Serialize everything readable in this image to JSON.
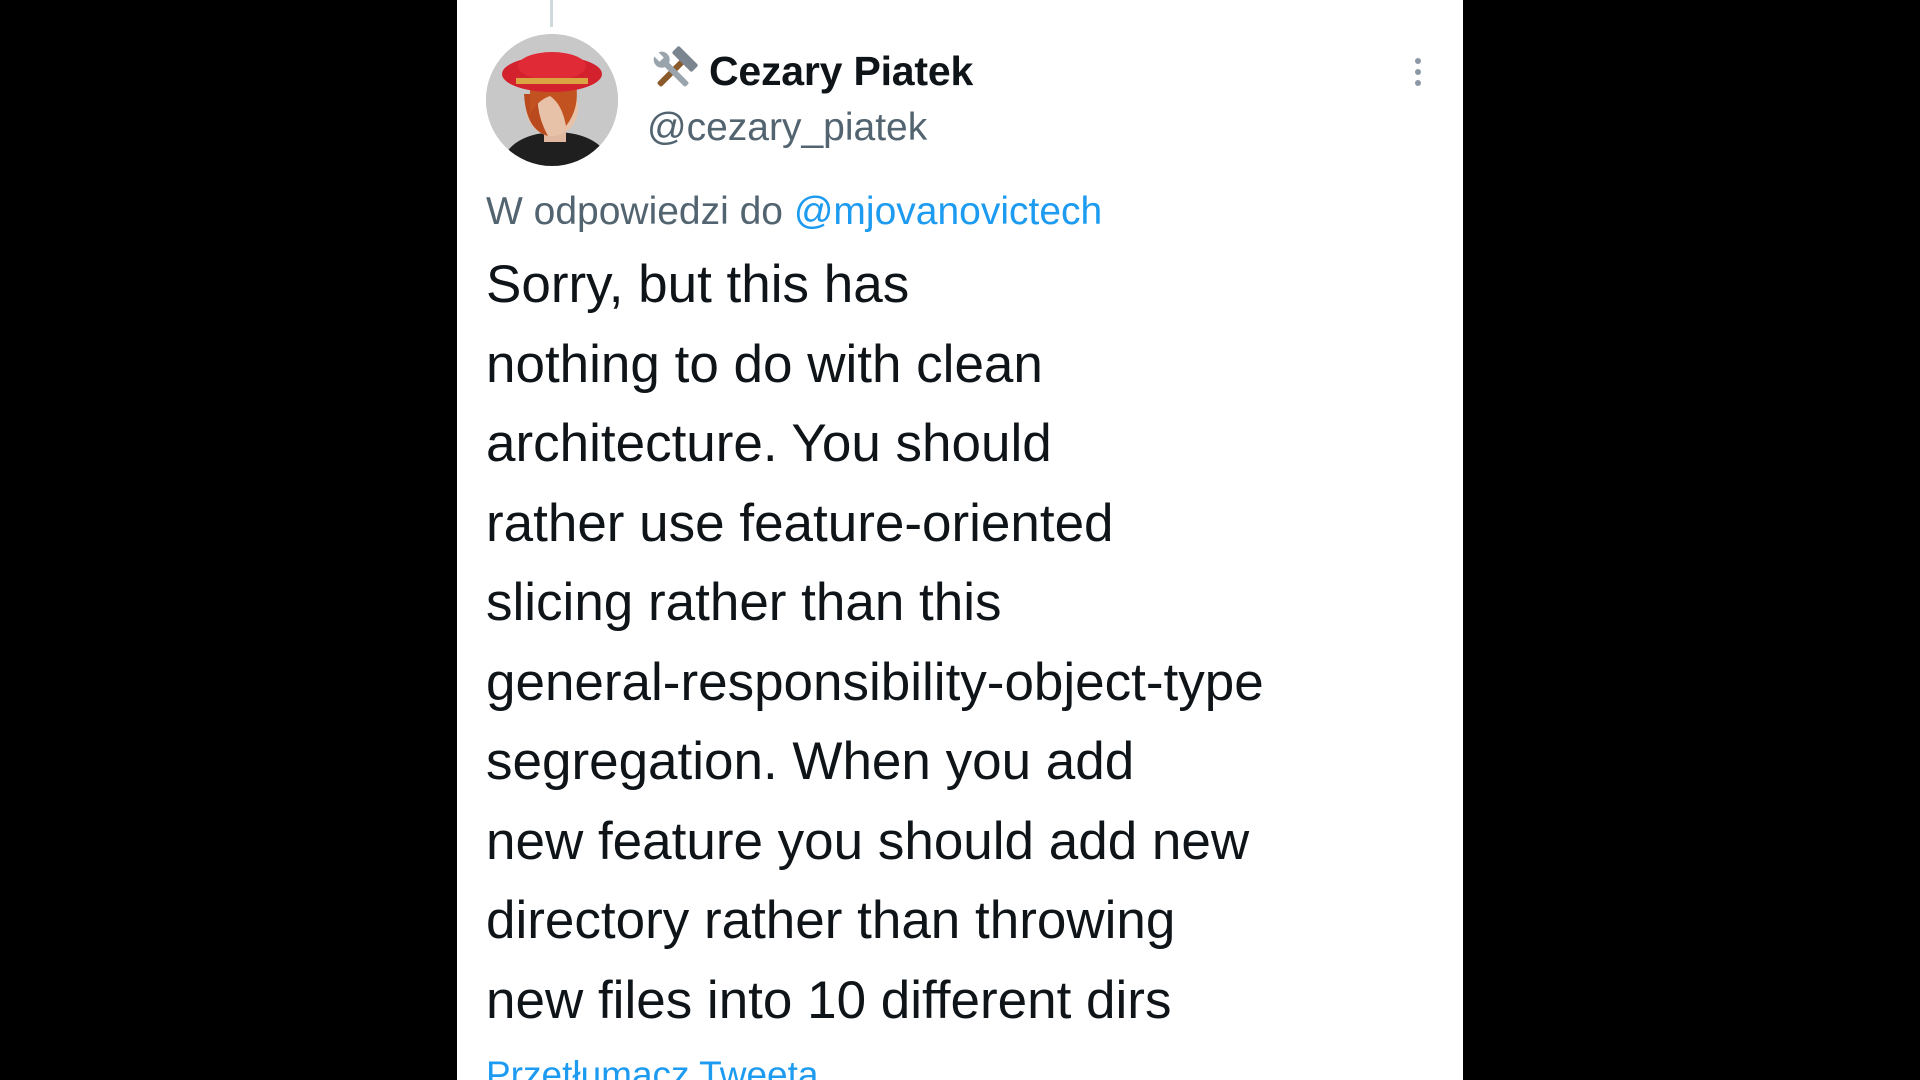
{
  "tweet": {
    "author": {
      "display_name": "Cezary Piatek",
      "handle": "@cezary_piatek",
      "name_emoji": "hammer-and-wrench-icon",
      "avatar": "profile-photo-red-hat"
    },
    "more_icon": "more-vertical-icon",
    "reply_prefix": "W odpowiedzi do ",
    "reply_to": "@mjovanovictech",
    "text": "Sorry, but this has\nnothing to do with clean\narchitecture. You should\nrather use feature-oriented\nslicing rather than this\ngeneral-responsibility-object-type\nsegregation.  When you add\nnew feature you should add new\ndirectory rather than throwing\nnew files into 10 different dirs",
    "translate_label": "Przetłumacz Tweeta"
  },
  "colors": {
    "background": "#000000",
    "card": "#ffffff",
    "text_primary": "#0f1419",
    "text_secondary": "#536471",
    "link": "#1d9bf0"
  }
}
